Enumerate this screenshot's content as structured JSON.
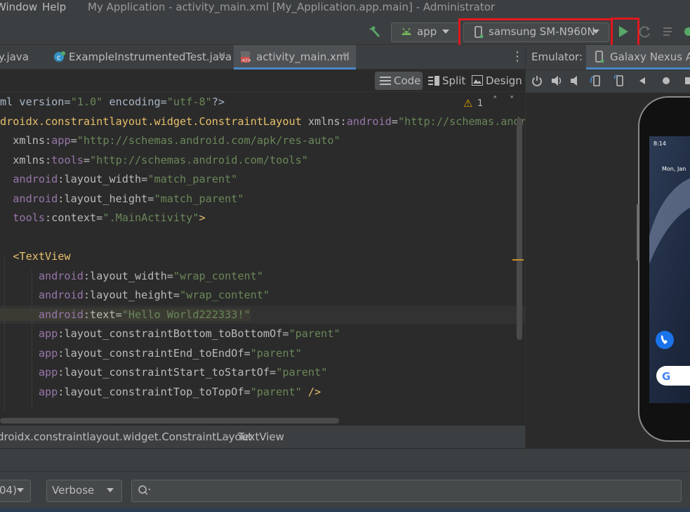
{
  "menu": {
    "window": "Window",
    "help": "Help"
  },
  "window_title": "My Application - activity_main.xml [My_Application.app.main] - Administrator",
  "toolbar": {
    "run_config": "app",
    "device": "samsung SM-N960N"
  },
  "tabs": [
    {
      "label": "y.java",
      "active": false
    },
    {
      "label": "ExampleInstrumentedTest.java",
      "active": false
    },
    {
      "label": "activity_main.xml",
      "active": true
    }
  ],
  "view_modes": {
    "code": "Code",
    "split": "Split",
    "design": "Design"
  },
  "inspection": {
    "warnings": "1"
  },
  "code_lines": [
    [
      [
        "t-plain",
        "ml version="
      ],
      [
        "t-val",
        "\"1.0\""
      ],
      [
        "t-plain",
        " encoding="
      ],
      [
        "t-val",
        "\"utf-8\""
      ],
      [
        "t-plain",
        "?>"
      ]
    ],
    [
      [
        "t-tag",
        "droidx.constraintlayout.widget.ConstraintLayout"
      ],
      [
        "t-attr",
        " xmlns:"
      ],
      [
        "t-ns",
        "android"
      ],
      [
        "t-attr",
        "="
      ],
      [
        "t-val",
        "\"http://schemas.android.com/apk/res/android\""
      ]
    ],
    [
      [
        "t-attr",
        "  xmlns:"
      ],
      [
        "t-ns",
        "app"
      ],
      [
        "t-attr",
        "="
      ],
      [
        "t-val",
        "\"http://schemas.android.com/apk/res-auto\""
      ]
    ],
    [
      [
        "t-attr",
        "  xmlns:"
      ],
      [
        "t-ns",
        "tools"
      ],
      [
        "t-attr",
        "="
      ],
      [
        "t-val",
        "\"http://schemas.android.com/tools\""
      ]
    ],
    [
      [
        "t-ns",
        "  android"
      ],
      [
        "t-attr",
        ":layout_width="
      ],
      [
        "t-val",
        "\"match_parent\""
      ]
    ],
    [
      [
        "t-ns",
        "  android"
      ],
      [
        "t-attr",
        ":layout_height="
      ],
      [
        "t-val",
        "\"match_parent\""
      ]
    ],
    [
      [
        "t-ns",
        "  tools"
      ],
      [
        "t-attr",
        ":context="
      ],
      [
        "t-val",
        "\".MainActivity\""
      ],
      [
        "t-tag",
        ">"
      ]
    ],
    [
      [
        "t-plain",
        ""
      ]
    ],
    [
      [
        "t-tag",
        "  <TextView"
      ]
    ],
    [
      [
        "t-ns",
        "      android"
      ],
      [
        "t-attr",
        ":layout_width="
      ],
      [
        "t-val",
        "\"wrap_content\""
      ]
    ],
    [
      [
        "t-ns",
        "      android"
      ],
      [
        "t-attr",
        ":layout_height="
      ],
      [
        "t-val",
        "\"wrap_content\""
      ]
    ],
    [
      [
        "t-ns",
        "      android"
      ],
      [
        "t-attr",
        ":text="
      ],
      [
        "t-val",
        "\"Hello World222333!\""
      ]
    ],
    [
      [
        "t-ns",
        "      app"
      ],
      [
        "t-attr",
        ":layout_constraintBottom_toBottomOf="
      ],
      [
        "t-val",
        "\"parent\""
      ]
    ],
    [
      [
        "t-ns",
        "      app"
      ],
      [
        "t-attr",
        ":layout_constraintEnd_toEndOf="
      ],
      [
        "t-val",
        "\"parent\""
      ]
    ],
    [
      [
        "t-ns",
        "      app"
      ],
      [
        "t-attr",
        ":layout_constraintStart_toStartOf="
      ],
      [
        "t-val",
        "\"parent\""
      ]
    ],
    [
      [
        "t-ns",
        "      app"
      ],
      [
        "t-attr",
        ":layout_constraintTop_toTopOf="
      ],
      [
        "t-val",
        "\"parent\""
      ],
      [
        "t-tag",
        " />"
      ]
    ]
  ],
  "breadcrumb": {
    "first": "droidx.constraintlayout.widget.ConstraintLayout",
    "second": "TextView"
  },
  "emulator": {
    "label": "Emulator:",
    "device_tab": "Galaxy Nexus API",
    "phone": {
      "time": "8:14",
      "date": "Mon, Jan"
    }
  },
  "logcat": {
    "process": "04)",
    "level": "Verbose",
    "search_placeholder": ""
  },
  "colors": {
    "accent": "#4a88c7",
    "highlight_red": "#e0181e",
    "run_green": "#59a869"
  }
}
